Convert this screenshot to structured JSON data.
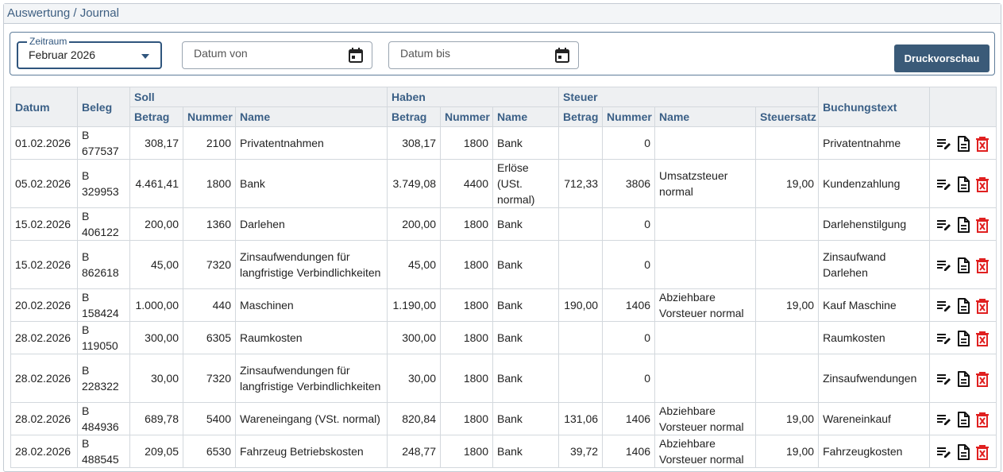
{
  "header": {
    "title": "Auswertung / Journal"
  },
  "filters": {
    "zeitraum_label": "Zeitraum",
    "zeitraum_value": "Februar 2026",
    "datum_von_placeholder": "Datum von",
    "datum_bis_placeholder": "Datum bis",
    "print_button": "Druckvorschau"
  },
  "table": {
    "groups": {
      "datum": "Datum",
      "beleg": "Beleg",
      "soll": "Soll",
      "haben": "Haben",
      "steuer": "Steuer",
      "buchungstext": "Buchungstext"
    },
    "subheaders": {
      "betrag": "Betrag",
      "nummer": "Nummer",
      "name": "Name",
      "steuersatz": "Steuersatz"
    },
    "rows": [
      {
        "datum": "01.02.2026",
        "beleg": [
          "B",
          "677537"
        ],
        "soll_betrag": "308,17",
        "soll_nummer": "2100",
        "soll_name": "Privatentnahmen",
        "haben_betrag": "308,17",
        "haben_nummer": "1800",
        "haben_name": "Bank",
        "steuer_betrag": "",
        "steuer_nummer": "0",
        "steuer_name": "",
        "steuersatz": "",
        "buchungstext": "Privatentnahme"
      },
      {
        "datum": "05.02.2026",
        "beleg": [
          "B",
          "329953"
        ],
        "soll_betrag": "4.461,41",
        "soll_nummer": "1800",
        "soll_name": "Bank",
        "haben_betrag": "3.749,08",
        "haben_nummer": "4400",
        "haben_name": "Erlöse (USt. normal)",
        "steuer_betrag": "712,33",
        "steuer_nummer": "3806",
        "steuer_name": "Umsatzsteuer normal",
        "steuersatz": "19,00",
        "buchungstext": "Kundenzahlung"
      },
      {
        "datum": "15.02.2026",
        "beleg": [
          "B",
          "406122"
        ],
        "soll_betrag": "200,00",
        "soll_nummer": "1360",
        "soll_name": "Darlehen",
        "haben_betrag": "200,00",
        "haben_nummer": "1800",
        "haben_name": "Bank",
        "steuer_betrag": "",
        "steuer_nummer": "0",
        "steuer_name": "",
        "steuersatz": "",
        "buchungstext": "Darlehenstilgung"
      },
      {
        "datum": "15.02.2026",
        "beleg": [
          "B",
          "862618"
        ],
        "soll_betrag": "45,00",
        "soll_nummer": "7320",
        "soll_name": "Zinsaufwendungen für langfristige Verbindlichkeiten",
        "haben_betrag": "45,00",
        "haben_nummer": "1800",
        "haben_name": "Bank",
        "steuer_betrag": "",
        "steuer_nummer": "0",
        "steuer_name": "",
        "steuersatz": "",
        "buchungstext": "Zinsaufwand Darlehen"
      },
      {
        "datum": "20.02.2026",
        "beleg": [
          "B",
          "158424"
        ],
        "soll_betrag": "1.000,00",
        "soll_nummer": "440",
        "soll_name": "Maschinen",
        "haben_betrag": "1.190,00",
        "haben_nummer": "1800",
        "haben_name": "Bank",
        "steuer_betrag": "190,00",
        "steuer_nummer": "1406",
        "steuer_name": "Abziehbare Vorsteuer normal",
        "steuersatz": "19,00",
        "buchungstext": "Kauf Maschine"
      },
      {
        "datum": "28.02.2026",
        "beleg": [
          "B",
          "119050"
        ],
        "soll_betrag": "300,00",
        "soll_nummer": "6305",
        "soll_name": "Raumkosten",
        "haben_betrag": "300,00",
        "haben_nummer": "1800",
        "haben_name": "Bank",
        "steuer_betrag": "",
        "steuer_nummer": "0",
        "steuer_name": "",
        "steuersatz": "",
        "buchungstext": "Raumkosten"
      },
      {
        "datum": "28.02.2026",
        "beleg": [
          "B",
          "228322"
        ],
        "soll_betrag": "30,00",
        "soll_nummer": "7320",
        "soll_name": "Zinsaufwendungen für langfristige Verbindlichkeiten",
        "haben_betrag": "30,00",
        "haben_nummer": "1800",
        "haben_name": "Bank",
        "steuer_betrag": "",
        "steuer_nummer": "0",
        "steuer_name": "",
        "steuersatz": "",
        "buchungstext": "Zinsaufwendungen"
      },
      {
        "datum": "28.02.2026",
        "beleg": [
          "B",
          "484936"
        ],
        "soll_betrag": "689,78",
        "soll_nummer": "5400",
        "soll_name": "Wareneingang (VSt. normal)",
        "haben_betrag": "820,84",
        "haben_nummer": "1800",
        "haben_name": "Bank",
        "steuer_betrag": "131,06",
        "steuer_nummer": "1406",
        "steuer_name": "Abziehbare Vorsteuer normal",
        "steuersatz": "19,00",
        "buchungstext": "Wareneinkauf"
      },
      {
        "datum": "28.02.2026",
        "beleg": [
          "B",
          "488545"
        ],
        "soll_betrag": "209,05",
        "soll_nummer": "6530",
        "soll_name": "Fahrzeug Betriebskosten",
        "haben_betrag": "248,77",
        "haben_nummer": "1800",
        "haben_name": "Bank",
        "steuer_betrag": "39,72",
        "steuer_nummer": "1406",
        "steuer_name": "Abziehbare Vorsteuer normal",
        "steuersatz": "19,00",
        "buchungstext": "Fahrzeugkosten"
      }
    ],
    "row_actions": [
      "edit-icon",
      "document-icon",
      "delete-icon"
    ]
  },
  "colors": {
    "accent": "#3a5a78",
    "header_text": "#3a5f86",
    "delete": "#e02020"
  }
}
